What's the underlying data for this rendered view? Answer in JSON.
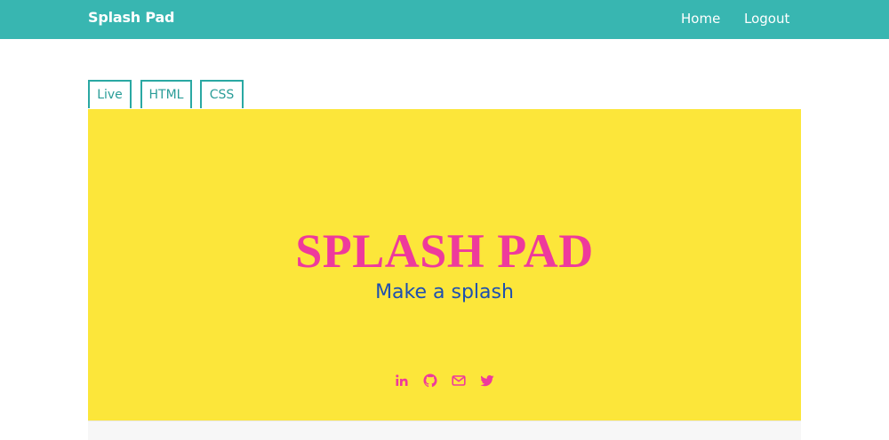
{
  "navbar": {
    "brand": "Splash Pad",
    "links": [
      {
        "label": "Home"
      },
      {
        "label": "Logout"
      }
    ],
    "background_color": "#38b6b1"
  },
  "tabs": [
    {
      "label": "Live"
    },
    {
      "label": "HTML"
    },
    {
      "label": "CSS"
    }
  ],
  "preview": {
    "background_color": "#fce63a",
    "title": "SPLASH PAD",
    "title_color": "#ee3a9c",
    "subtitle": "Make a splash",
    "subtitle_color": "#1d4fb0",
    "social_icons": [
      "linkedin-icon",
      "github-icon",
      "envelope-icon",
      "twitter-icon"
    ],
    "icon_color": "#ee3a9c"
  }
}
